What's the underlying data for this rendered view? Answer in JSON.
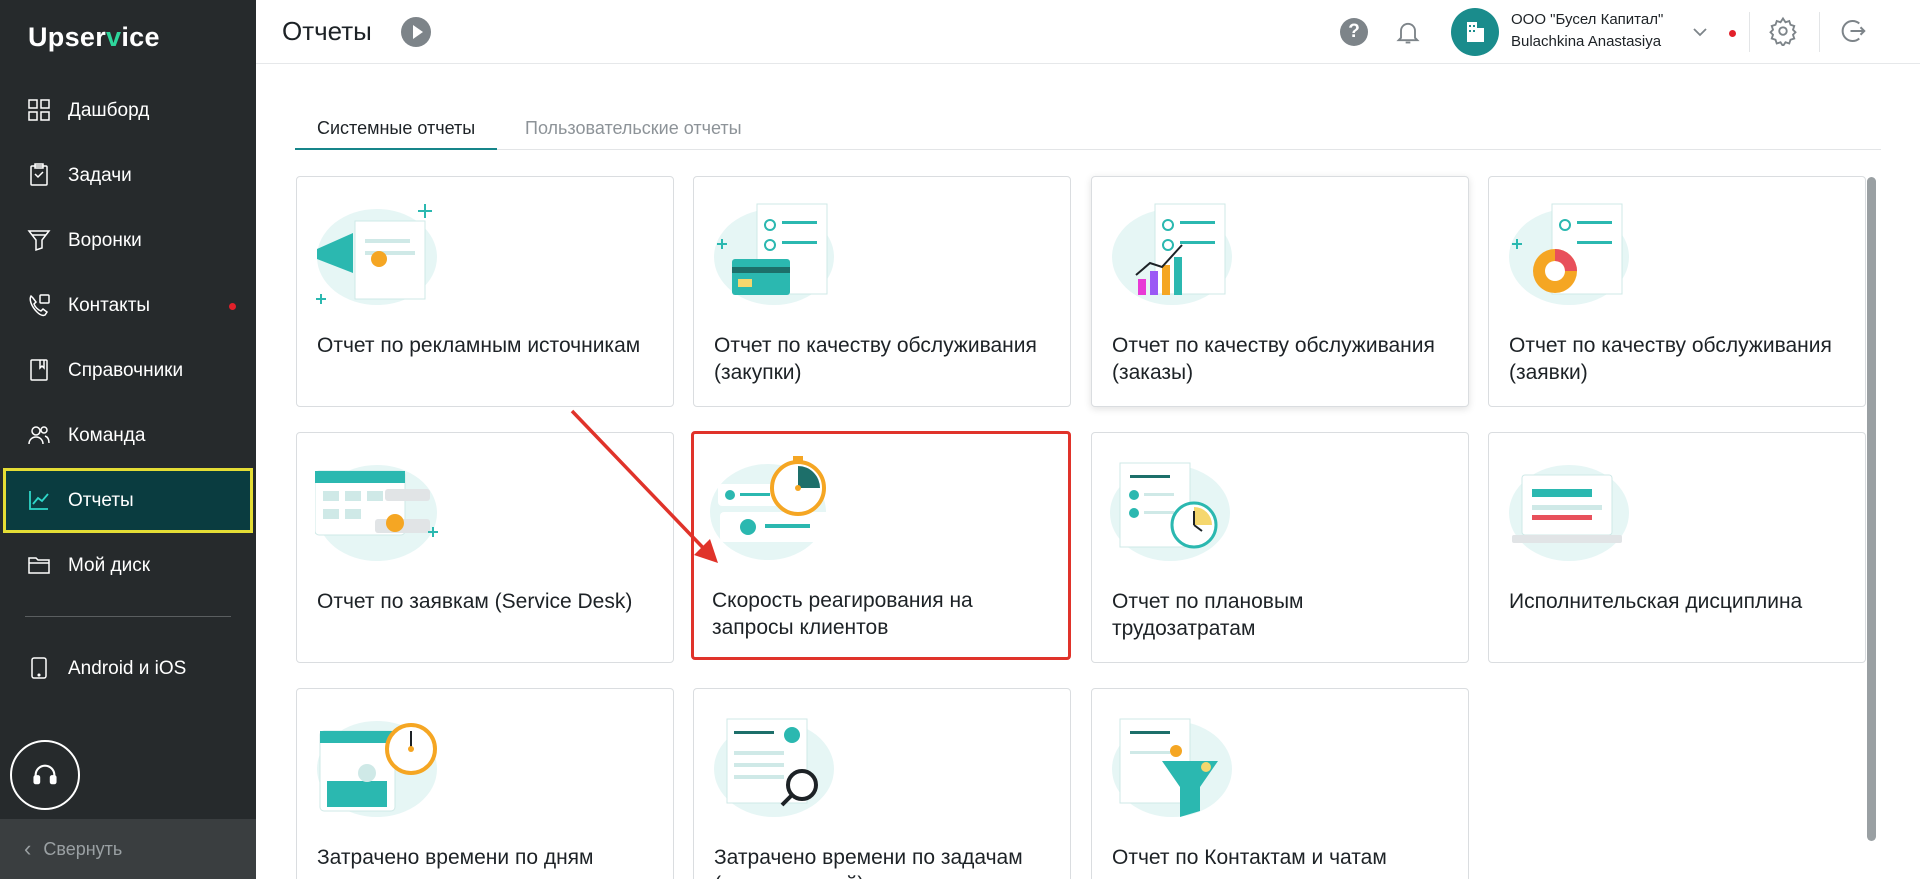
{
  "app": {
    "logo_prefix": "Upser",
    "logo_v": "v",
    "logo_suffix": "ice"
  },
  "sidebar": {
    "items": [
      {
        "label": "Дашборд",
        "icon": "grid-icon"
      },
      {
        "label": "Задачи",
        "icon": "tasks-icon"
      },
      {
        "label": "Воронки",
        "icon": "funnel-icon"
      },
      {
        "label": "Контакты",
        "icon": "contacts-icon",
        "notification": true
      },
      {
        "label": "Справочники",
        "icon": "book-icon"
      },
      {
        "label": "Команда",
        "icon": "team-icon"
      },
      {
        "label": "Отчеты",
        "icon": "chart-icon",
        "active": true
      },
      {
        "label": "Мой диск",
        "icon": "folder-icon"
      }
    ],
    "android_label": "Android и iOS",
    "collapse_label": "Свернуть"
  },
  "header": {
    "title": "Отчеты",
    "org_name": "ООО \"Бусел Капитал\"",
    "user_name": "Bulachkina Anastasiya"
  },
  "tabs": [
    {
      "label": "Системные отчеты",
      "active": true
    },
    {
      "label": "Пользовательские отчеты",
      "active": false
    }
  ],
  "cards": [
    {
      "title": "Отчет по рекламным источникам"
    },
    {
      "title": "Отчет по качеству обслуживания (закупки)"
    },
    {
      "title": "Отчет по качеству обслуживания (заказы)"
    },
    {
      "title": "Отчет по качеству обслуживания (заявки)"
    },
    {
      "title": "Отчет по заявкам (Service Desk)"
    },
    {
      "title": "Скорость реагирования на запросы клиентов"
    },
    {
      "title": "Отчет по плановым трудозатратам"
    },
    {
      "title": "Исполнительская дисциплина"
    },
    {
      "title": "Затрачено времени по дням"
    },
    {
      "title": "Затрачено времени по задачам (исполнителей)"
    },
    {
      "title": "Отчет по Контактам и чатам"
    }
  ],
  "colors": {
    "sidebar_bg": "#262a2c",
    "active_bg": "#0a3c40",
    "active_outline": "#e4dd35",
    "accent": "#16858a",
    "highlight": "#e0332a"
  }
}
